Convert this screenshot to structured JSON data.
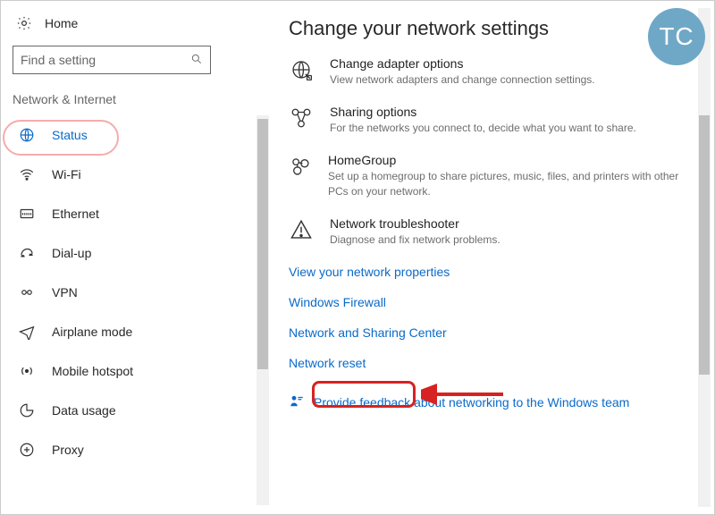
{
  "sidebar": {
    "home_label": "Home",
    "search_placeholder": "Find a setting",
    "section_label": "Network & Internet",
    "items": [
      {
        "label": "Status",
        "icon": "status-icon",
        "active": true
      },
      {
        "label": "Wi-Fi",
        "icon": "wifi-icon",
        "active": false
      },
      {
        "label": "Ethernet",
        "icon": "ethernet-icon",
        "active": false
      },
      {
        "label": "Dial-up",
        "icon": "dialup-icon",
        "active": false
      },
      {
        "label": "VPN",
        "icon": "vpn-icon",
        "active": false
      },
      {
        "label": "Airplane mode",
        "icon": "airplane-icon",
        "active": false
      },
      {
        "label": "Mobile hotspot",
        "icon": "hotspot-icon",
        "active": false
      },
      {
        "label": "Data usage",
        "icon": "datausage-icon",
        "active": false
      },
      {
        "label": "Proxy",
        "icon": "proxy-icon",
        "active": false
      }
    ]
  },
  "main": {
    "heading": "Change your network settings",
    "options": [
      {
        "icon": "adapter-icon",
        "title": "Change adapter options",
        "desc": "View network adapters and change connection settings."
      },
      {
        "icon": "sharing-icon",
        "title": "Sharing options",
        "desc": "For the networks you connect to, decide what you want to share."
      },
      {
        "icon": "homegroup-icon",
        "title": "HomeGroup",
        "desc": "Set up a homegroup to share pictures, music, files, and printers with other PCs on your network."
      },
      {
        "icon": "troubleshoot-icon",
        "title": "Network troubleshooter",
        "desc": "Diagnose and fix network problems."
      }
    ],
    "links": [
      "View your network properties",
      "Windows Firewall",
      "Network and Sharing Center",
      "Network reset"
    ],
    "feedback_label": "Provide feedback about networking to the Windows team"
  },
  "badge": "TC"
}
